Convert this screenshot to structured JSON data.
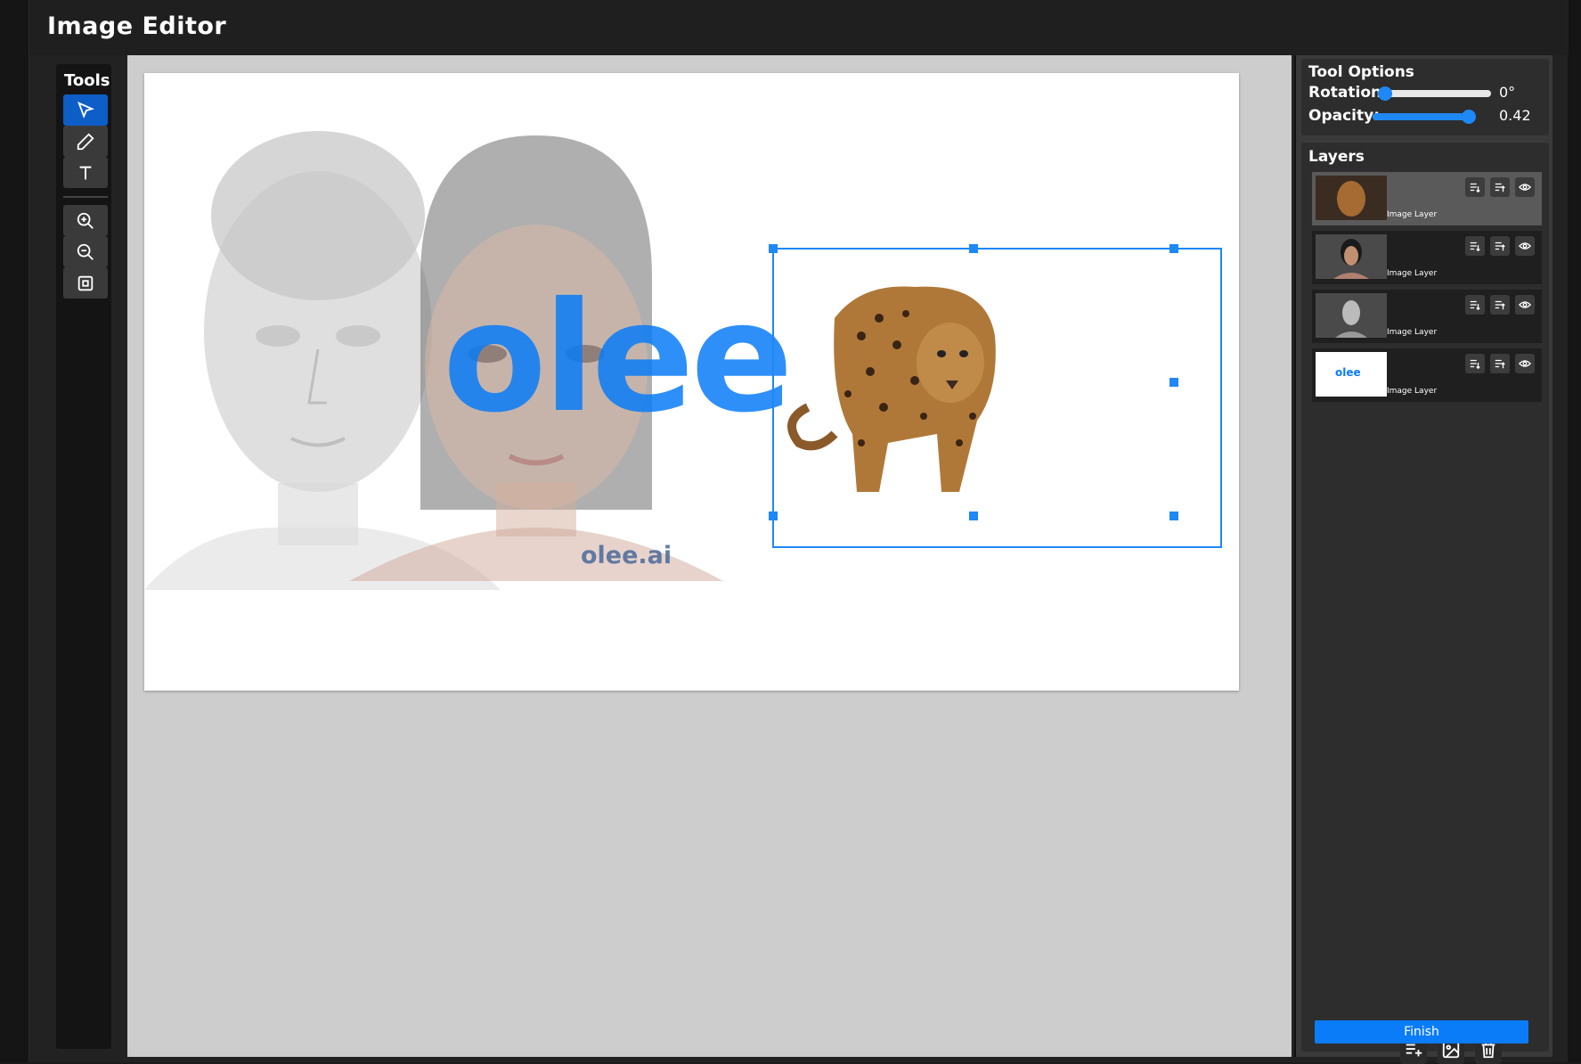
{
  "window": {
    "title": "Image Editor"
  },
  "tools": {
    "label": "Tools",
    "items": [
      {
        "name": "select",
        "icon": "pointer-icon",
        "active": true
      },
      {
        "name": "pen",
        "icon": "pencil-icon"
      },
      {
        "name": "text",
        "icon": "text-icon"
      },
      {
        "name": "zoom-in",
        "icon": "zoom-in-icon"
      },
      {
        "name": "zoom-out",
        "icon": "zoom-out-icon"
      },
      {
        "name": "fit",
        "icon": "fit-screen-icon"
      }
    ]
  },
  "canvas": {
    "logo_text": "olee",
    "watermark": "olee.ai",
    "accent": "#1e88f5"
  },
  "tool_options": {
    "head": "Tool Options",
    "rotation_label": "Rotation:",
    "rotation_value": "0°",
    "rotation_fraction": 0.0,
    "opacity_label": "Opacity:",
    "opacity_value": "0.42",
    "opacity_fraction": 1.0
  },
  "layers": {
    "head": "Layers",
    "items": [
      {
        "name": "Image Layer",
        "thumb": "jaguar",
        "active": true
      },
      {
        "name": "Image Layer",
        "thumb": "woman"
      },
      {
        "name": "Image Layer",
        "thumb": "sculpture"
      },
      {
        "name": "Image Layer",
        "thumb": "logo",
        "thumb_text": "olee"
      }
    ]
  },
  "actions": {
    "finish": "Finish"
  },
  "colors": {
    "primary": "#0a7cf7",
    "panel": "#2d2d2d",
    "canvas_bg": "#cdcdcd"
  }
}
